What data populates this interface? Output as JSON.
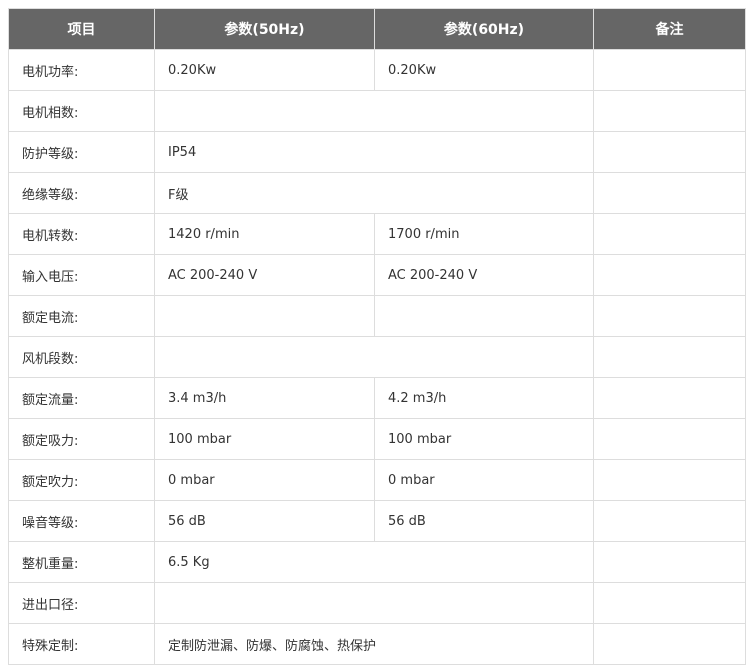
{
  "table": {
    "headers": [
      "项目",
      "参数(50Hz)",
      "参数(60Hz)",
      "备注"
    ],
    "rows": [
      {
        "label": "电机功率:",
        "v50": "0.20Kw",
        "v60": "0.20Kw",
        "note": "",
        "merged": false
      },
      {
        "label": "电机相数:",
        "v50": "",
        "v60": "",
        "note": "",
        "merged": true
      },
      {
        "label": "防护等级:",
        "v50": "IP54",
        "v60": "",
        "note": "",
        "merged": true
      },
      {
        "label": "绝缘等级:",
        "v50": "F级",
        "v60": "",
        "note": "",
        "merged": true
      },
      {
        "label": "电机转数:",
        "v50": "1420 r/min",
        "v60": "1700 r/min",
        "note": "",
        "merged": false
      },
      {
        "label": "输入电压:",
        "v50": "AC 200-240 V",
        "v60": "AC 200-240 V",
        "note": "",
        "merged": false
      },
      {
        "label": "额定电流:",
        "v50": "",
        "v60": "",
        "note": "",
        "merged": false
      },
      {
        "label": "风机段数:",
        "v50": "",
        "v60": "",
        "note": "",
        "merged": true
      },
      {
        "label": "额定流量:",
        "v50": "3.4 m3/h",
        "v60": "4.2 m3/h",
        "note": "",
        "merged": false
      },
      {
        "label": "额定吸力:",
        "v50": "100 mbar",
        "v60": "100 mbar",
        "note": "",
        "merged": false
      },
      {
        "label": "额定吹力:",
        "v50": "0 mbar",
        "v60": "0 mbar",
        "note": "",
        "merged": false
      },
      {
        "label": "噪音等级:",
        "v50": "56 dB",
        "v60": "56 dB",
        "note": "",
        "merged": false
      },
      {
        "label": "整机重量:",
        "v50": "6.5 Kg",
        "v60": "",
        "note": "",
        "merged": true
      },
      {
        "label": "进出口径:",
        "v50": "",
        "v60": "",
        "note": "",
        "merged": true
      },
      {
        "label": "特殊定制:",
        "v50": "定制防泄漏、防爆、防腐蚀、热保护",
        "v60": "",
        "note": "",
        "merged": true
      }
    ]
  },
  "colors": {
    "header_bg": "#666666",
    "header_text": "#ffffff",
    "border": "#dddddd",
    "cell_text": "#333333"
  }
}
